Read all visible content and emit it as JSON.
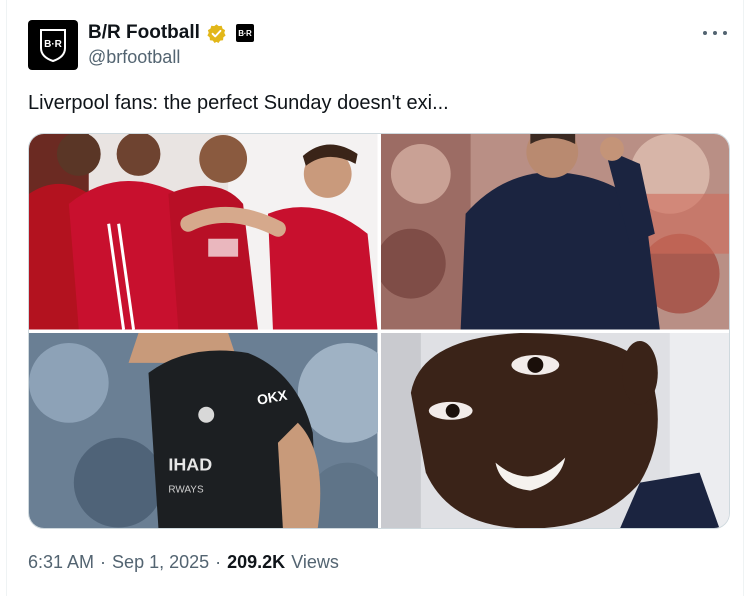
{
  "account": {
    "display_name": "B/R Football",
    "handle": "@brfootball",
    "avatar_text": "B·R",
    "affiliate_text": "B·R"
  },
  "tweet": {
    "text": "Liverpool fans: the perfect Sunday doesn't exi...",
    "time": "6:31 AM",
    "date": "Sep 1, 2025",
    "views_count": "209.2K",
    "views_label": "Views",
    "separator": "·"
  },
  "media": [
    {
      "label": "Players in red kits celebrating"
    },
    {
      "label": "Man in dark sweater with hand on head"
    },
    {
      "label": "Player in black kit"
    },
    {
      "label": "Smiling player close-up"
    }
  ],
  "colors": {
    "verified_gold": "#e2b719",
    "text_primary": "#0f1419",
    "text_secondary": "#536471",
    "kit_red": "#c8102e"
  }
}
